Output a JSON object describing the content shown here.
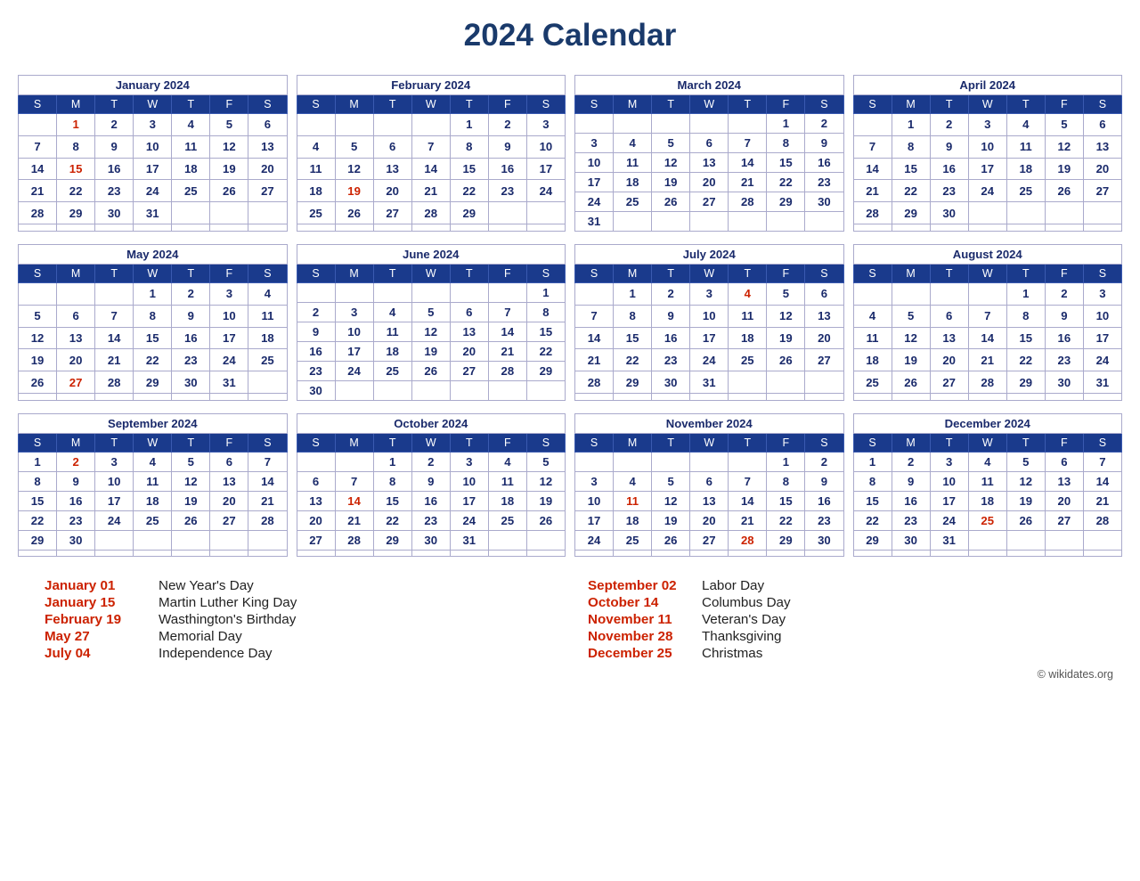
{
  "title": "2024 Calendar",
  "months": [
    {
      "name": "January 2024",
      "days_header": [
        "S",
        "M",
        "T",
        "W",
        "T",
        "F",
        "S"
      ],
      "weeks": [
        [
          "",
          "1",
          "2",
          "3",
          "4",
          "5",
          "6"
        ],
        [
          "7",
          "8",
          "9",
          "10",
          "11",
          "12",
          "13"
        ],
        [
          "14",
          "15",
          "16",
          "17",
          "18",
          "19",
          "20"
        ],
        [
          "21",
          "22",
          "23",
          "24",
          "25",
          "26",
          "27"
        ],
        [
          "28",
          "29",
          "30",
          "31",
          "",
          "",
          ""
        ]
      ],
      "holidays": [
        "1",
        "15"
      ]
    },
    {
      "name": "February 2024",
      "days_header": [
        "S",
        "M",
        "T",
        "W",
        "T",
        "F",
        "S"
      ],
      "weeks": [
        [
          "",
          "",
          "",
          "",
          "1",
          "2",
          "3"
        ],
        [
          "4",
          "5",
          "6",
          "7",
          "8",
          "9",
          "10"
        ],
        [
          "11",
          "12",
          "13",
          "14",
          "15",
          "16",
          "17"
        ],
        [
          "18",
          "19",
          "20",
          "21",
          "22",
          "23",
          "24"
        ],
        [
          "25",
          "26",
          "27",
          "28",
          "29",
          "",
          ""
        ]
      ],
      "holidays": [
        "19"
      ]
    },
    {
      "name": "March 2024",
      "days_header": [
        "S",
        "M",
        "T",
        "W",
        "T",
        "F",
        "S"
      ],
      "weeks": [
        [
          "",
          "",
          "",
          "",
          "",
          "1",
          "2"
        ],
        [
          "3",
          "4",
          "5",
          "6",
          "7",
          "8",
          "9"
        ],
        [
          "10",
          "11",
          "12",
          "13",
          "14",
          "15",
          "16"
        ],
        [
          "17",
          "18",
          "19",
          "20",
          "21",
          "22",
          "23"
        ],
        [
          "24",
          "25",
          "26",
          "27",
          "28",
          "29",
          "30"
        ],
        [
          "31",
          "",
          "",
          "",
          "",
          "",
          ""
        ]
      ],
      "holidays": []
    },
    {
      "name": "April 2024",
      "days_header": [
        "S",
        "M",
        "T",
        "W",
        "T",
        "F",
        "S"
      ],
      "weeks": [
        [
          "",
          "1",
          "2",
          "3",
          "4",
          "5",
          "6"
        ],
        [
          "7",
          "8",
          "9",
          "10",
          "11",
          "12",
          "13"
        ],
        [
          "14",
          "15",
          "16",
          "17",
          "18",
          "19",
          "20"
        ],
        [
          "21",
          "22",
          "23",
          "24",
          "25",
          "26",
          "27"
        ],
        [
          "28",
          "29",
          "30",
          "",
          "",
          "",
          ""
        ]
      ],
      "holidays": []
    },
    {
      "name": "May 2024",
      "days_header": [
        "S",
        "M",
        "T",
        "W",
        "T",
        "F",
        "S"
      ],
      "weeks": [
        [
          "",
          "",
          "",
          "1",
          "2",
          "3",
          "4"
        ],
        [
          "5",
          "6",
          "7",
          "8",
          "9",
          "10",
          "11"
        ],
        [
          "12",
          "13",
          "14",
          "15",
          "16",
          "17",
          "18"
        ],
        [
          "19",
          "20",
          "21",
          "22",
          "23",
          "24",
          "25"
        ],
        [
          "26",
          "27",
          "28",
          "29",
          "30",
          "31",
          ""
        ]
      ],
      "holidays": [
        "27"
      ]
    },
    {
      "name": "June 2024",
      "days_header": [
        "S",
        "M",
        "T",
        "W",
        "T",
        "F",
        "S"
      ],
      "weeks": [
        [
          "",
          "",
          "",
          "",
          "",
          "",
          "1"
        ],
        [
          "2",
          "3",
          "4",
          "5",
          "6",
          "7",
          "8"
        ],
        [
          "9",
          "10",
          "11",
          "12",
          "13",
          "14",
          "15"
        ],
        [
          "16",
          "17",
          "18",
          "19",
          "20",
          "21",
          "22"
        ],
        [
          "23",
          "24",
          "25",
          "26",
          "27",
          "28",
          "29"
        ],
        [
          "30",
          "",
          "",
          "",
          "",
          "",
          ""
        ]
      ],
      "holidays": []
    },
    {
      "name": "July 2024",
      "days_header": [
        "S",
        "M",
        "T",
        "W",
        "T",
        "F",
        "S"
      ],
      "weeks": [
        [
          "",
          "1",
          "2",
          "3",
          "4",
          "5",
          "6"
        ],
        [
          "7",
          "8",
          "9",
          "10",
          "11",
          "12",
          "13"
        ],
        [
          "14",
          "15",
          "16",
          "17",
          "18",
          "19",
          "20"
        ],
        [
          "21",
          "22",
          "23",
          "24",
          "25",
          "26",
          "27"
        ],
        [
          "28",
          "29",
          "30",
          "31",
          "",
          "",
          ""
        ]
      ],
      "holidays": [
        "4"
      ]
    },
    {
      "name": "August 2024",
      "days_header": [
        "S",
        "M",
        "T",
        "W",
        "T",
        "F",
        "S"
      ],
      "weeks": [
        [
          "",
          "",
          "",
          "",
          "1",
          "2",
          "3"
        ],
        [
          "4",
          "5",
          "6",
          "7",
          "8",
          "9",
          "10"
        ],
        [
          "11",
          "12",
          "13",
          "14",
          "15",
          "16",
          "17"
        ],
        [
          "18",
          "19",
          "20",
          "21",
          "22",
          "23",
          "24"
        ],
        [
          "25",
          "26",
          "27",
          "28",
          "29",
          "30",
          "31"
        ]
      ],
      "holidays": []
    },
    {
      "name": "September 2024",
      "days_header": [
        "S",
        "M",
        "T",
        "W",
        "T",
        "F",
        "S"
      ],
      "weeks": [
        [
          "1",
          "2",
          "3",
          "4",
          "5",
          "6",
          "7"
        ],
        [
          "8",
          "9",
          "10",
          "11",
          "12",
          "13",
          "14"
        ],
        [
          "15",
          "16",
          "17",
          "18",
          "19",
          "20",
          "21"
        ],
        [
          "22",
          "23",
          "24",
          "25",
          "26",
          "27",
          "28"
        ],
        [
          "29",
          "30",
          "",
          "",
          "",
          "",
          ""
        ]
      ],
      "holidays": [
        "2"
      ]
    },
    {
      "name": "October 2024",
      "days_header": [
        "S",
        "M",
        "T",
        "W",
        "T",
        "F",
        "S"
      ],
      "weeks": [
        [
          "",
          "",
          "1",
          "2",
          "3",
          "4",
          "5"
        ],
        [
          "6",
          "7",
          "8",
          "9",
          "10",
          "11",
          "12"
        ],
        [
          "13",
          "14",
          "15",
          "16",
          "17",
          "18",
          "19"
        ],
        [
          "20",
          "21",
          "22",
          "23",
          "24",
          "25",
          "26"
        ],
        [
          "27",
          "28",
          "29",
          "30",
          "31",
          "",
          ""
        ]
      ],
      "holidays": [
        "14"
      ]
    },
    {
      "name": "November 2024",
      "days_header": [
        "S",
        "M",
        "T",
        "W",
        "T",
        "F",
        "S"
      ],
      "weeks": [
        [
          "",
          "",
          "",
          "",
          "",
          "1",
          "2"
        ],
        [
          "3",
          "4",
          "5",
          "6",
          "7",
          "8",
          "9"
        ],
        [
          "10",
          "11",
          "12",
          "13",
          "14",
          "15",
          "16"
        ],
        [
          "17",
          "18",
          "19",
          "20",
          "21",
          "22",
          "23"
        ],
        [
          "24",
          "25",
          "26",
          "27",
          "28",
          "29",
          "30"
        ]
      ],
      "holidays": [
        "11",
        "28"
      ]
    },
    {
      "name": "December 2024",
      "days_header": [
        "S",
        "M",
        "T",
        "W",
        "T",
        "F",
        "S"
      ],
      "weeks": [
        [
          "1",
          "2",
          "3",
          "4",
          "5",
          "6",
          "7"
        ],
        [
          "8",
          "9",
          "10",
          "11",
          "12",
          "13",
          "14"
        ],
        [
          "15",
          "16",
          "17",
          "18",
          "19",
          "20",
          "21"
        ],
        [
          "22",
          "23",
          "24",
          "25",
          "26",
          "27",
          "28"
        ],
        [
          "29",
          "30",
          "31",
          "",
          "",
          "",
          ""
        ]
      ],
      "holidays": [
        "25"
      ]
    }
  ],
  "holidays_left": [
    {
      "date": "January 01",
      "name": "New Year's Day"
    },
    {
      "date": "January 15",
      "name": "Martin Luther King Day"
    },
    {
      "date": "February 19",
      "name": "Wasthington's Birthday"
    },
    {
      "date": "May 27",
      "name": "Memorial Day"
    },
    {
      "date": "July 04",
      "name": "Independence Day"
    }
  ],
  "holidays_right": [
    {
      "date": "September 02",
      "name": "Labor Day"
    },
    {
      "date": "October 14",
      "name": "Columbus Day"
    },
    {
      "date": "November 11",
      "name": "Veteran's Day"
    },
    {
      "date": "November 28",
      "name": "Thanksgiving"
    },
    {
      "date": "December 25",
      "name": "Christmas"
    }
  ],
  "copyright": "© wikidates.org"
}
